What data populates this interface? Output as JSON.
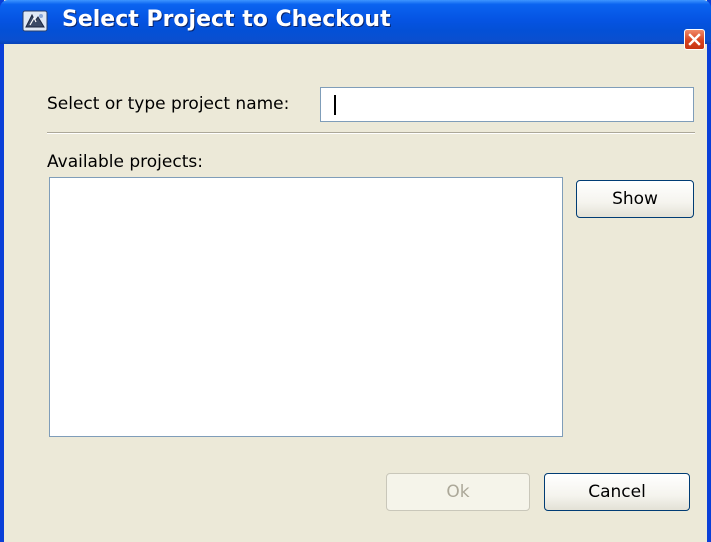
{
  "window": {
    "title": "Select Project to Checkout",
    "icon": "app-icon",
    "close_icon": "close-icon"
  },
  "form": {
    "name_label": "Select or type project name:",
    "name_value": "",
    "available_label": "Available projects:",
    "projects": []
  },
  "buttons": {
    "show_label": "Show",
    "ok_label": "Ok",
    "ok_enabled": false,
    "cancel_label": "Cancel"
  },
  "colors": {
    "titlebar": "#0554e3",
    "dialog_bg": "#ece9d8",
    "close_button": "#d8431f"
  }
}
